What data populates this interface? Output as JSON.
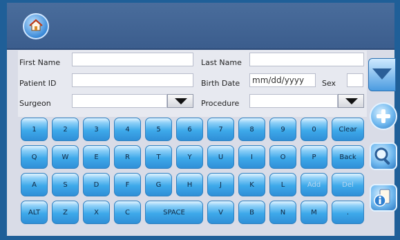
{
  "form": {
    "first_name_label": "First Name",
    "first_name_value": "",
    "last_name_label": "Last Name",
    "last_name_value": "",
    "patient_id_label": "Patient ID",
    "patient_id_value": "",
    "birth_date_label": "Birth Date",
    "birth_date_value": "mm/dd/yyyy",
    "sex_label": "Sex",
    "sex_value": "",
    "surgeon_label": "Surgeon",
    "surgeon_value": "",
    "procedure_label": "Procedure",
    "procedure_value": ""
  },
  "keys": {
    "k1": "1",
    "k2": "2",
    "k3": "3",
    "k4": "4",
    "k5": "5",
    "k6": "6",
    "k7": "7",
    "k8": "8",
    "k9": "9",
    "k0": "0",
    "clear": "Clear",
    "q": "Q",
    "w": "W",
    "e": "E",
    "r": "R",
    "t": "T",
    "y": "Y",
    "u": "U",
    "i": "I",
    "o": "O",
    "p": "P",
    "back": "Back",
    "a": "A",
    "s": "S",
    "d": "D",
    "f": "F",
    "g": "G",
    "h": "H",
    "j": "J",
    "k": "K",
    "l": "L",
    "add": "Add",
    "del": "Del",
    "alt": "ALT",
    "z": "Z",
    "x": "X",
    "c": "C",
    "space": "SPACE",
    "v": "V",
    "b": "B",
    "n": "N",
    "m": "M",
    "dot": "."
  },
  "icons": {
    "home": "home-icon",
    "scroll_down": "chevron-down-icon",
    "add": "plus-icon",
    "search": "search-icon",
    "info": "info-icon"
  },
  "colors": {
    "title_bar": "#3b5d8d",
    "key_blue": "#3ea9ea",
    "frame": "#1f5f98"
  }
}
